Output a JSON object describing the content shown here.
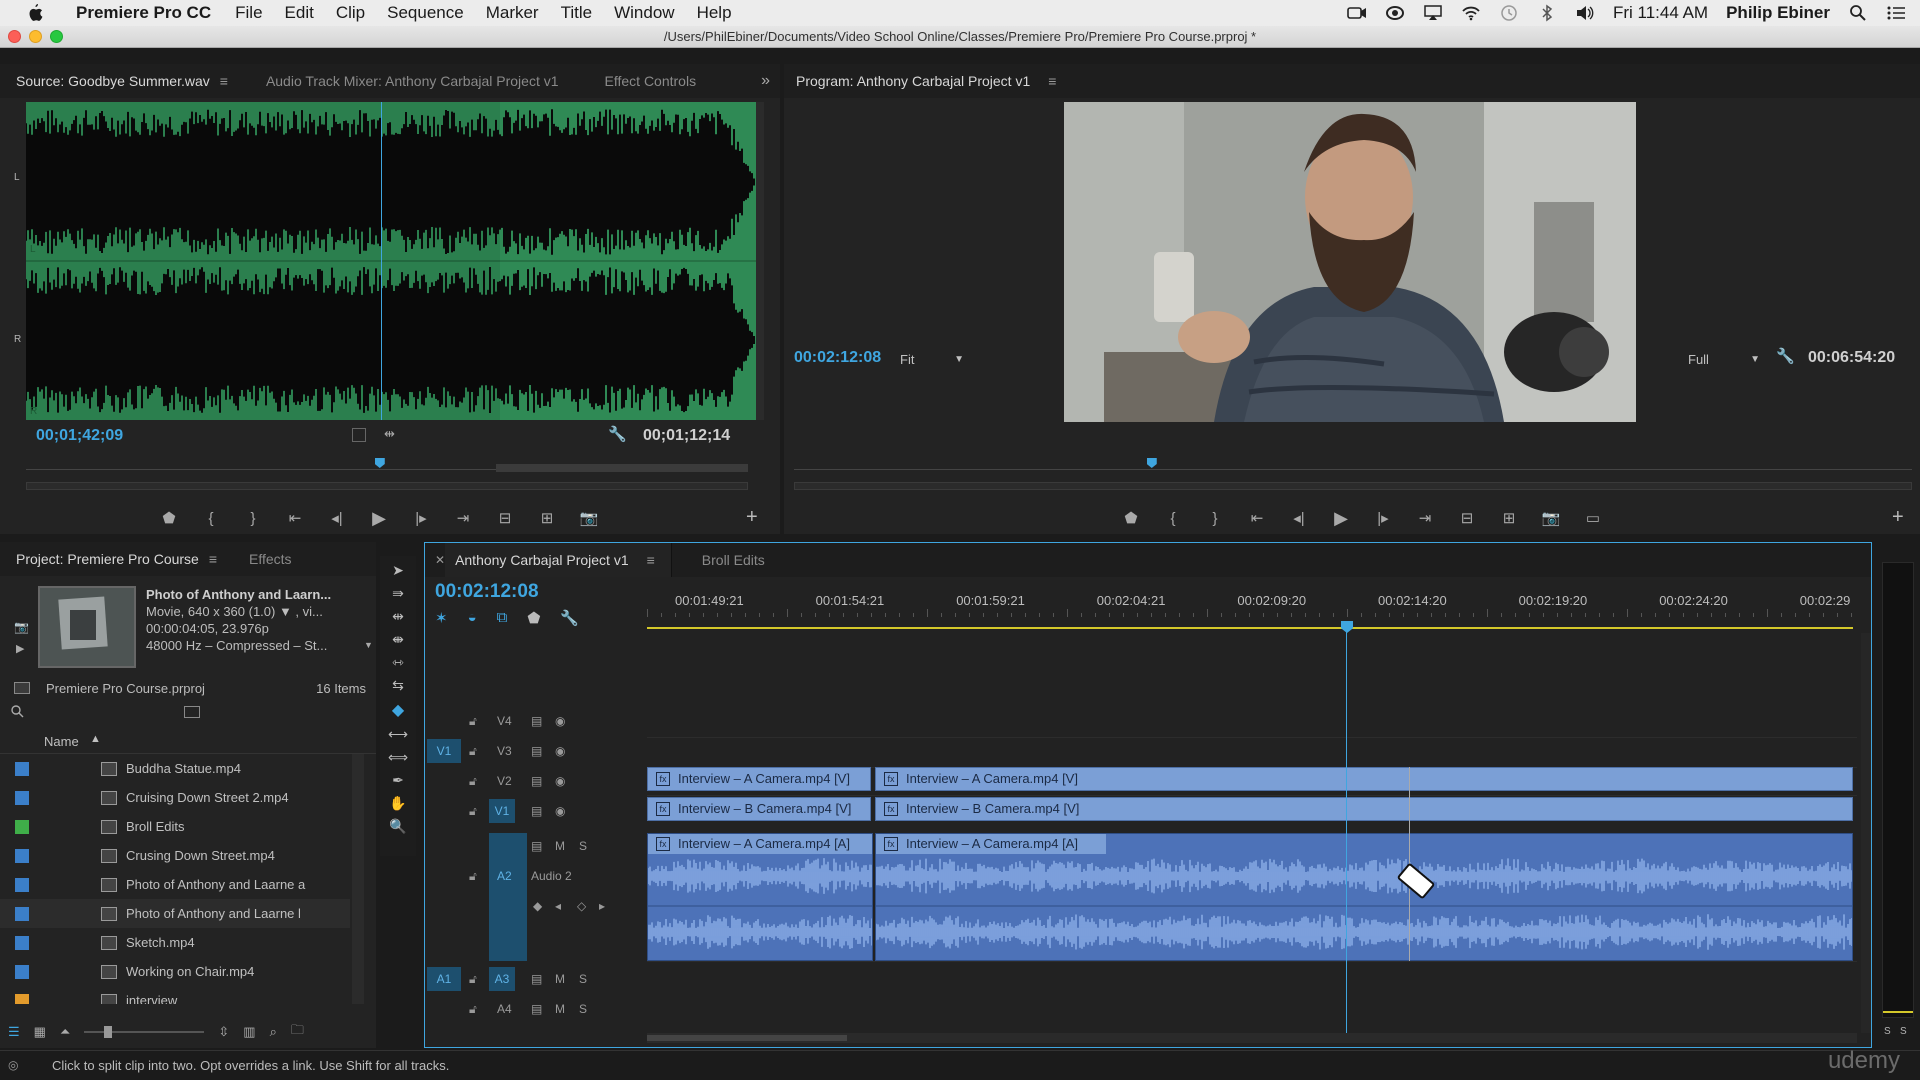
{
  "menubar": {
    "app": "Premiere Pro CC",
    "items": [
      "File",
      "Edit",
      "Clip",
      "Sequence",
      "Marker",
      "Title",
      "Window",
      "Help"
    ],
    "clock": "Fri 11:44 AM",
    "user": "Philip Ebiner"
  },
  "window": {
    "path": "/Users/PhilEbiner/Documents/Video School Online/Classes/Premiere Pro/Premiere Pro Course.prproj *"
  },
  "source_panel": {
    "tabs": [
      "Source: Goodbye Summer.wav",
      "Audio Track Mixer: Anthony Carbajal Project v1",
      "Effect Controls"
    ],
    "channel_labels": [
      "L",
      "L",
      "R",
      "R"
    ],
    "timecode_current": "00;01;42;09",
    "timecode_duration": "00;01;12;14",
    "playhead_fraction": 0.49
  },
  "program_panel": {
    "tab": "Program: Anthony Carbajal Project v1",
    "timecode_current": "00:02:12:08",
    "zoom": "Fit",
    "quality": "Full",
    "timecode_duration": "00:06:54:20",
    "playhead_fraction": 0.32
  },
  "project_panel": {
    "tabs": [
      "Project: Premiere Pro Course",
      "Effects"
    ],
    "preview_title": "Photo of Anthony and Laarn...",
    "preview_line2": "Movie, 640 x 360 (1.0) ▼ , vi...",
    "preview_line3": "00:00:04:05, 23.976p",
    "preview_line4": "48000 Hz – Compressed – St...",
    "project_file": "Premiere Pro Course.prproj",
    "item_count": "16 Items",
    "column_name": "Name",
    "items": [
      {
        "name": "Buddha Statue.mp4",
        "color": "#3b7fc9"
      },
      {
        "name": "Cruising Down Street 2.mp4",
        "color": "#3b7fc9"
      },
      {
        "name": "Broll Edits",
        "color": "#3fae49"
      },
      {
        "name": "Crusing Down Street.mp4",
        "color": "#3b7fc9"
      },
      {
        "name": "Photo of Anthony and Laarne a",
        "color": "#3b7fc9"
      },
      {
        "name": "Photo of Anthony and Laarne l",
        "color": "#3b7fc9"
      },
      {
        "name": "Sketch.mp4",
        "color": "#3b7fc9"
      },
      {
        "name": "Working on Chair.mp4",
        "color": "#3b7fc9"
      },
      {
        "name": "interview",
        "color": "#e39b2c"
      }
    ]
  },
  "timeline": {
    "tabs": [
      "Anthony Carbajal Project v1",
      "Broll Edits"
    ],
    "timecode": "00:02:12:08",
    "ruler": [
      "00:01:49:21",
      "00:01:54:21",
      "00:01:59:21",
      "00:02:04:21",
      "00:02:09:20",
      "00:02:14:20",
      "00:02:19:20",
      "00:02:24:20",
      "00:02:29"
    ],
    "tracks": {
      "v4": "V4",
      "v3": "V3",
      "v2": "V2",
      "v1": "V1",
      "a2": "A2",
      "a3": "A3",
      "a4": "A4",
      "a2_name": "Audio 2",
      "src_v1": "V1",
      "src_a1": "A1",
      "m": "M",
      "s": "S"
    },
    "clips": {
      "v2_a": "Interview – A Camera.mp4 [V]",
      "v2_b": "Interview – A Camera.mp4 [V]",
      "v1_a": "Interview – B Camera.mp4 [V]",
      "v1_b": "Interview – B Camera.mp4 [V]",
      "a2_a": "Interview – A Camera.mp4 [A]",
      "a2_b": "Interview – A Camera.mp4 [A]"
    },
    "meter_labels": [
      "S",
      "S"
    ]
  },
  "status": {
    "text": "Click to split clip into two. Opt overrides a link. Use Shift for all tracks.",
    "watermark": "udemy"
  },
  "colors": {
    "accent": "#3fa6e0",
    "waveform_bg": "#2f8a55",
    "clip_video": "#7b9fd6",
    "clip_audio": "#4d72b8",
    "work_area": "#d4c82a"
  }
}
